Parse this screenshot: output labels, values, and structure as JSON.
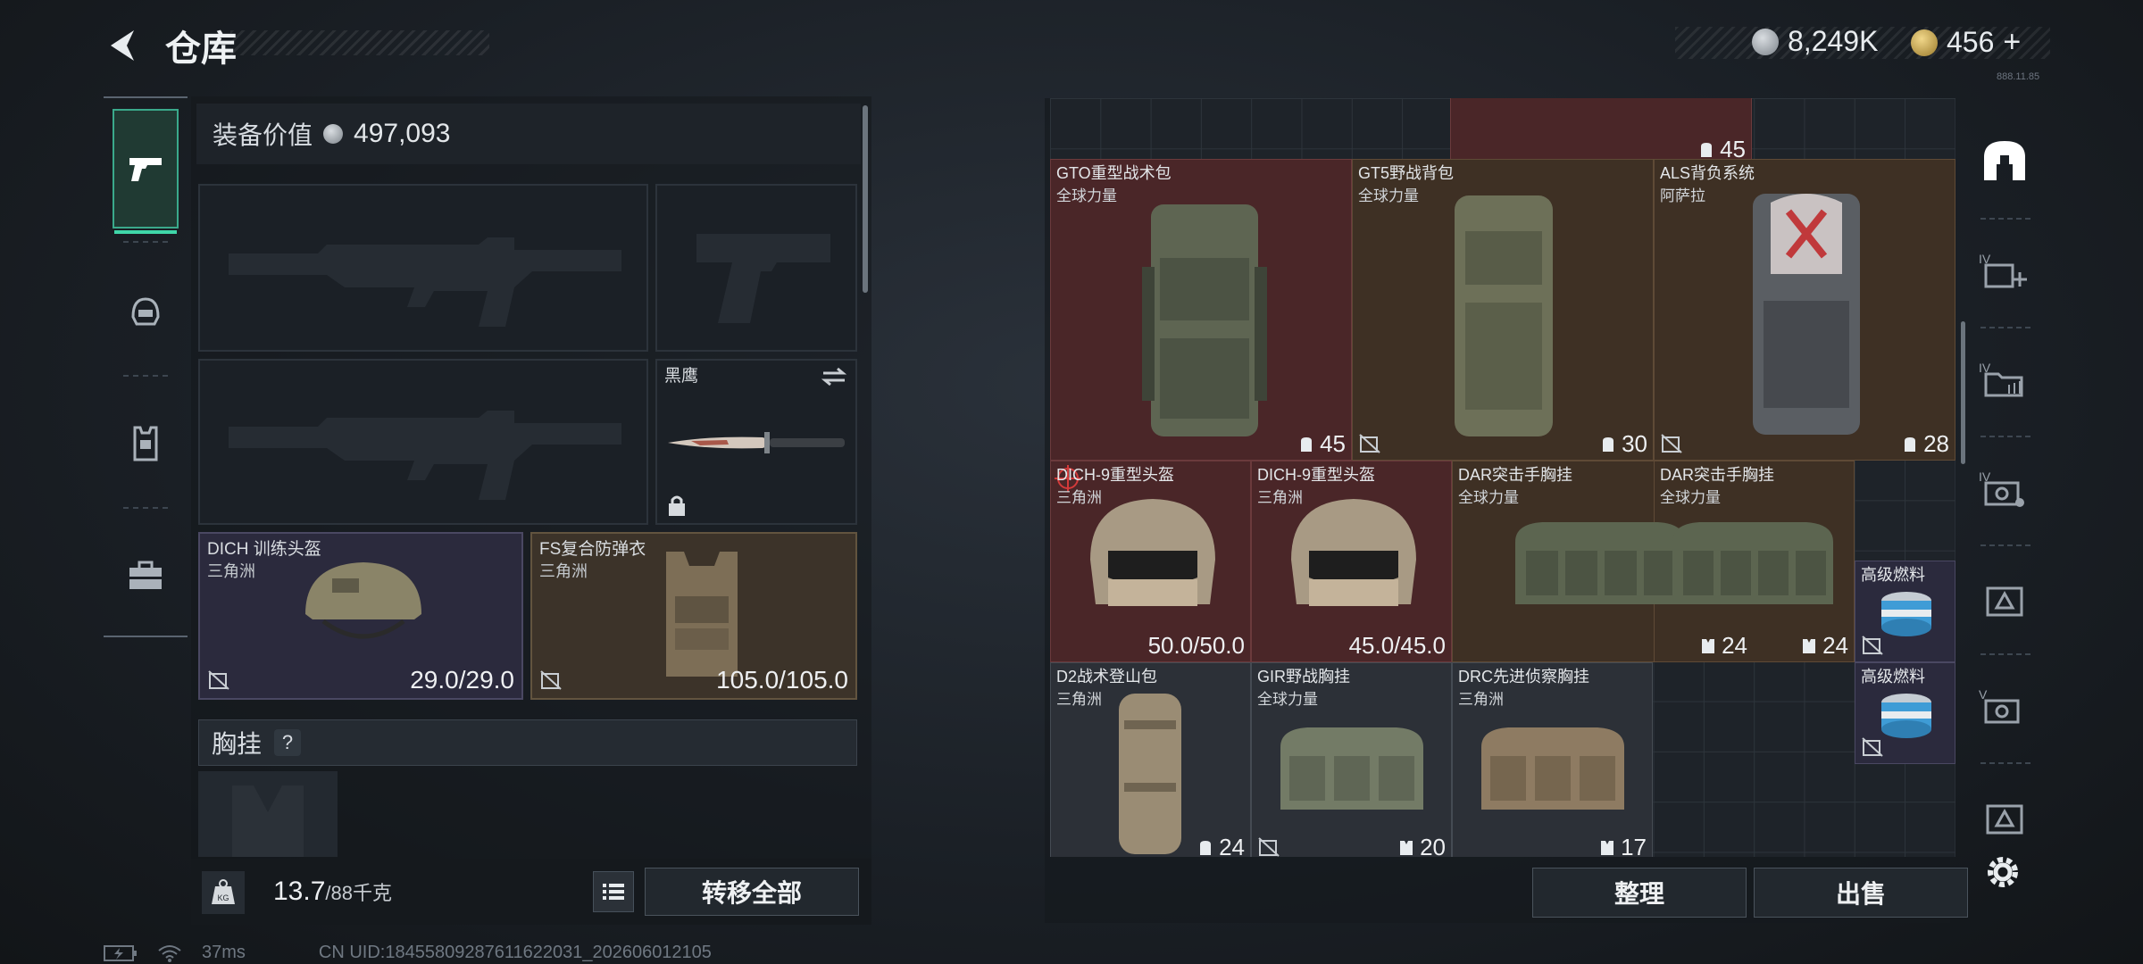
{
  "header": {
    "title": "仓库",
    "currency_silver": "8,249K",
    "currency_gold": "456",
    "currency_add": "+",
    "version": "888.11.85"
  },
  "loadout": {
    "value_label": "装备价值",
    "value": "497,093",
    "knife_name": "黑鹰",
    "helmet": {
      "name": "DICH 训练头盔",
      "origin": "三角洲",
      "durability": "29.0/29.0"
    },
    "armor": {
      "name": "FS复合防弹衣",
      "origin": "三角洲",
      "durability": "105.0/105.0"
    },
    "chest_label": "胸挂",
    "chest_help": "?",
    "weight": "13.7",
    "weight_max": "/88千克",
    "kg_label": "KG",
    "transfer_all": "转移全部"
  },
  "stash": {
    "top_partial_cap": "45",
    "items": [
      {
        "name": "GTO重型战术包",
        "origin": "全球力量",
        "cap": "45"
      },
      {
        "name": "GT5野战背包",
        "origin": "全球力量",
        "cap": "30"
      },
      {
        "name": "ALS背负系统",
        "origin": "阿萨拉",
        "cap": "28"
      },
      {
        "name": "DICH-9重型头盔",
        "origin": "三角洲",
        "cap": "50.0/50.0"
      },
      {
        "name": "DICH-9重型头盔",
        "origin": "三角洲",
        "cap": "45.0/45.0"
      },
      {
        "name": "DAR突击手胸挂",
        "origin": "全球力量",
        "cap": "24"
      },
      {
        "name": "DAR突击手胸挂",
        "origin": "全球力量",
        "cap": "24"
      },
      {
        "name": "高级燃料",
        "origin": "",
        "cap": ""
      },
      {
        "name": "D2战术登山包",
        "origin": "三角洲",
        "cap": "24"
      },
      {
        "name": "GIR野战胸挂",
        "origin": "全球力量",
        "cap": "20"
      },
      {
        "name": "DRC先进侦察胸挂",
        "origin": "三角洲",
        "cap": "17"
      },
      {
        "name": "高级燃料",
        "origin": "",
        "cap": ""
      }
    ],
    "sort": "整理",
    "sell": "出售"
  },
  "right_rail": {
    "labels": [
      "IV",
      "IV",
      "IV",
      "",
      "V",
      ""
    ]
  },
  "status": {
    "ping": "37ms",
    "uid": "CN UID:18455809287611622031_202606012105"
  },
  "colors": {
    "accent_green": "#3fd6a8",
    "rarity_red": "#4a2628",
    "rarity_brown": "#3e3024",
    "rarity_purple": "#2b2a3d"
  }
}
